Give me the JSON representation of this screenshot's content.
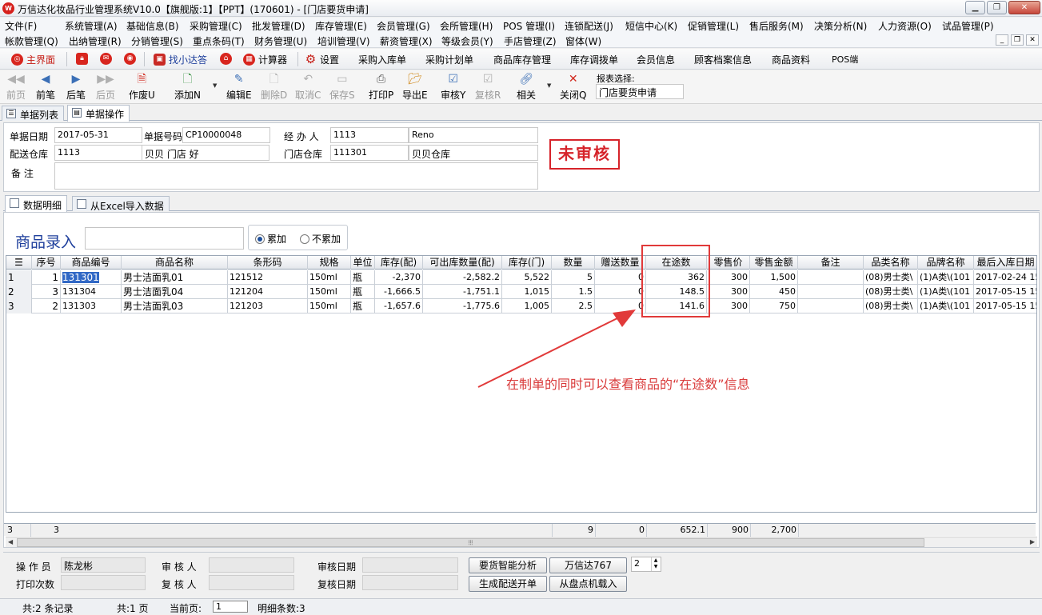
{
  "window": {
    "title": "万信达化妆品行业管理系统V10.0【旗舰版:1】【PPT】(170601) - [门店要货申请]",
    "controls": [
      "▁",
      "❐",
      "✕"
    ]
  },
  "menu": {
    "row1": [
      "文件(F)",
      "系统管理(A)",
      "基础信息(B)",
      "采购管理(C)",
      "批发管理(D)",
      "库存管理(E)",
      "会员管理(G)",
      "会所管理(H)",
      "POS 管理(I)",
      "连锁配送(J)",
      "短信中心(K)",
      "促销管理(L)",
      "售后服务(M)",
      "决策分析(N)",
      "人力资源(O)",
      "试品管理(P)"
    ],
    "row2": [
      "帐款管理(Q)",
      "出纳管理(R)",
      "分销管理(S)",
      "重点条码(T)",
      "财务管理(U)",
      "培训管理(V)",
      "薪资管理(X)",
      "等级会员(Y)",
      "手店管理(Z)",
      "窗体(W)"
    ]
  },
  "quickbar": {
    "main": "主界面",
    "find": "找小达答",
    "calc": "计算器",
    "settings": "设置",
    "links": [
      "采购入库单",
      "采购计划单",
      "商品库存管理",
      "库存调拨单",
      "会员信息",
      "顾客档案信息",
      "商品资料",
      "POS端"
    ]
  },
  "toolbar": {
    "first": "前页",
    "prev": "前笔",
    "next": "后笔",
    "last": "后页",
    "void": "作废U",
    "add": "添加N",
    "edit": "编辑E",
    "delete": "删除D",
    "cancel": "取消C",
    "save": "保存S",
    "print": "打印P",
    "export": "导出E",
    "audit": "审核Y",
    "reaudit": "复核R",
    "related": "相关",
    "close": "关闭Q",
    "report_label": "报表选择:",
    "report_value": "门店要货申请"
  },
  "tabs": [
    "单据列表",
    "单据操作"
  ],
  "form": {
    "date_label": "单据日期",
    "date": "2017-05-31",
    "docno_label": "单据号码",
    "docno": "CP10000048",
    "handler_label": "经 办 人",
    "handler_code": "1113",
    "handler_name": "Reno",
    "dist_label": "配送仓库",
    "dist_code": "1113",
    "dist_name": "贝贝 门店 好",
    "store_label": "门店仓库",
    "store_code": "111301",
    "store_name": "贝贝仓库",
    "remark_label": "备 注",
    "status_stamp": "未审核"
  },
  "subtabs": [
    "数据明细",
    "从Excel导入数据"
  ],
  "entry": {
    "label": "商品录入",
    "radio_accum": "累加",
    "radio_no_accum": "不累加"
  },
  "grid": {
    "columns": [
      "序号",
      "商品编号",
      "商品名称",
      "条形码",
      "规格",
      "单位",
      "库存(配)",
      "可出库数量(配)",
      "库存(门)",
      "数量",
      "赠送数量",
      "在途数",
      "零售价",
      "零售金额",
      "备注",
      "品类名称",
      "品牌名称",
      "最后入库日期"
    ],
    "rows": [
      {
        "idx": "1",
        "seq": "1",
        "code": "131301",
        "name": "男士洁面乳01",
        "barcode": "121512",
        "spec": "150ml",
        "unit": "瓶",
        "stock_dist": "-2,370",
        "avail": "-2,582.2",
        "stock_store": "5,522",
        "qty": "5",
        "gift": "0",
        "transit": "362",
        "price": "300",
        "amount": "1,500",
        "remark": "",
        "category": "(08)男士类\\",
        "brand": "(1)A类\\(101",
        "last_in": "2017-02-24 15"
      },
      {
        "idx": "2",
        "seq": "3",
        "code": "131304",
        "name": "男士洁面乳04",
        "barcode": "121204",
        "spec": "150ml",
        "unit": "瓶",
        "stock_dist": "-1,666.5",
        "avail": "-1,751.1",
        "stock_store": "1,015",
        "qty": "1.5",
        "gift": "0",
        "transit": "148.5",
        "price": "300",
        "amount": "450",
        "remark": "",
        "category": "(08)男士类\\",
        "brand": "(1)A类\\(101",
        "last_in": "2017-05-15 15"
      },
      {
        "idx": "3",
        "seq": "2",
        "code": "131303",
        "name": "男士洁面乳03",
        "barcode": "121203",
        "spec": "150ml",
        "unit": "瓶",
        "stock_dist": "-1,657.6",
        "avail": "-1,775.6",
        "stock_store": "1,005",
        "qty": "2.5",
        "gift": "0",
        "transit": "141.6",
        "price": "300",
        "amount": "750",
        "remark": "",
        "category": "(08)男士类\\",
        "brand": "(1)A类\\(101",
        "last_in": "2017-05-15 15"
      }
    ],
    "footer": {
      "idx": "3",
      "count": "3",
      "qty": "9",
      "gift": "0",
      "transit": "652.1",
      "price": "900",
      "amount": "2,700"
    }
  },
  "annotation": "在制单的同时可以查看商品的“在途数”信息",
  "bottom": {
    "operator_label": "操 作 员",
    "operator": "陈龙彬",
    "print_label": "打印次数",
    "auditor_label": "审 核 人",
    "reviewer_label": "复 核 人",
    "audit_date_label": "审核日期",
    "review_date_label": "复核日期",
    "btn_analysis": "要货智能分析",
    "btn_wxd": "万信达767",
    "spin_value": "2",
    "btn_gen": "生成配送开单",
    "btn_load": "从盘点机载入"
  },
  "status": {
    "records": "共:2 条记录",
    "pages": "共:1 页",
    "current_label": "当前页:",
    "current": "1",
    "detail": "明细条数:3"
  },
  "colors": {
    "accent": "#1e3f9c",
    "stamp": "#d6232a",
    "annotation": "#d93a3a",
    "selection": "#3168c5"
  }
}
